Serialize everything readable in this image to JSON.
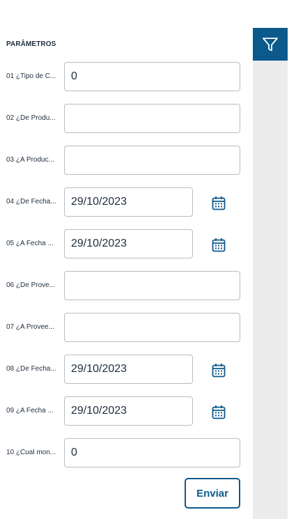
{
  "section_title": "PARÂMETROS",
  "params": [
    {
      "label": "01 ¿Tipo de C...",
      "value": "0"
    },
    {
      "label": "02 ¿De Produ...",
      "value": ""
    },
    {
      "label": "03 ¿A Produc...",
      "value": ""
    },
    {
      "label": "04 ¿De Fecha...",
      "value": "29/10/2023"
    },
    {
      "label": "05 ¿A Fecha ...",
      "value": "29/10/2023"
    },
    {
      "label": "06 ¿De Prove...",
      "value": ""
    },
    {
      "label": "07 ¿A Provee...",
      "value": ""
    },
    {
      "label": "08 ¿De Fecha...",
      "value": "29/10/2023"
    },
    {
      "label": "09 ¿A Fecha ...",
      "value": "29/10/2023"
    },
    {
      "label": "10 ¿Cual mon...",
      "value": "0"
    }
  ],
  "submit_label": "Enviar",
  "icons": {
    "filter": "filter-icon",
    "calendar": "calendar-icon"
  },
  "colors": {
    "accent": "#0c5a8c",
    "sidebar": "#ececec",
    "border": "#b9bcbf",
    "text": "#1f2d3d"
  }
}
